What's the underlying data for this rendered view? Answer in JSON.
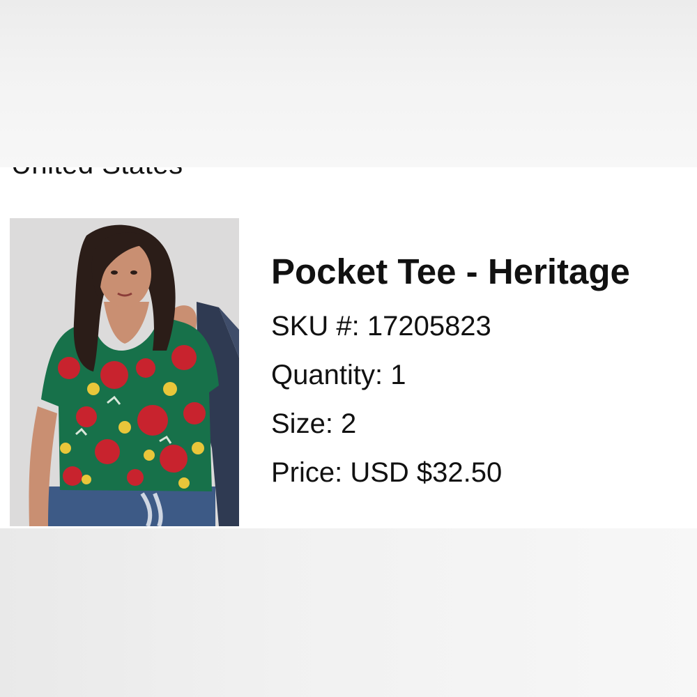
{
  "page": {
    "location_text": "United States"
  },
  "order_item": {
    "image_alt": "Model wearing green floral pocket tee",
    "title": "Pocket Tee - Heritage",
    "sku_line": "SKU #: 17205823",
    "quantity_line": "Quantity: 1",
    "size_line": "Size: 2",
    "price_line": "Price: USD $32.50"
  },
  "colors": {
    "shirt_green": "#17714a",
    "flower_red": "#c8232e",
    "flower_yellow": "#e9c63a",
    "denim": "#3d5a86",
    "jacket": "#2f3a52"
  }
}
